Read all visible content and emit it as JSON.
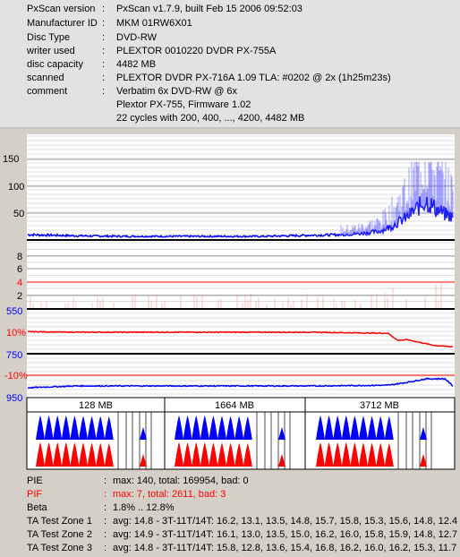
{
  "info": {
    "rows": [
      {
        "label": "PxScan version",
        "value": "PxScan v1.7.9, built Feb 15 2006 09:52:03"
      },
      {
        "label": "Manufacturer ID",
        "value": "MKM 01RW6X01"
      },
      {
        "label": "Disc Type",
        "value": "DVD-RW"
      },
      {
        "label": "writer used",
        "value": "PLEXTOR 0010220 DVDR PX-755A"
      },
      {
        "label": "disc capacity",
        "value": "4482 MB"
      },
      {
        "label": "scanned",
        "value": "PLEXTOR DVDR PX-716A 1.09 TLA: #0202 @ 2x (1h25m23s)"
      },
      {
        "label": "comment",
        "value": "Verbatim 6x DVD-RW @ 6x"
      }
    ],
    "comment_cont": [
      "Plextor PX-755, Firmware 1.02",
      "22 cycles with 200, 400, ..., 4200, 4482 MB"
    ],
    "separator": ":"
  },
  "chart_data": [
    {
      "type": "line",
      "name": "PIE",
      "ylim": [
        0,
        190
      ],
      "yticks": [
        "150",
        "100",
        "50"
      ],
      "xlim_mb": [
        0,
        4482
      ],
      "series": [
        {
          "color": "#0000ff",
          "x_mb": [
            0,
            500,
            1000,
            1500,
            2000,
            2500,
            3000,
            3300,
            3500,
            3700,
            3800,
            3900,
            4000,
            4100,
            4200,
            4300,
            4400,
            4482
          ],
          "y": [
            8,
            6,
            5,
            5,
            5,
            5,
            7,
            8,
            10,
            14,
            20,
            30,
            40,
            55,
            70,
            55,
            45,
            40
          ]
        }
      ]
    },
    {
      "type": "line",
      "name": "PIF",
      "ylim": [
        0,
        10
      ],
      "yticks": [
        "8",
        "6",
        "4",
        "2"
      ],
      "series": [
        {
          "color": "#ff9999",
          "x_mb": [
            0,
            1000,
            2000,
            3000,
            3500,
            4000,
            4482
          ],
          "y": [
            1,
            1,
            1,
            1,
            1,
            2,
            2
          ]
        }
      ]
    },
    {
      "type": "line",
      "name": "jitter",
      "yticks": [
        "550",
        "10%",
        "750"
      ],
      "series": [
        {
          "color": "#ff0000",
          "x_mb": [
            0,
            500,
            1000,
            2000,
            3000,
            3800,
            3900,
            4000,
            4300,
            4482
          ],
          "y": [
            10.1,
            10,
            10,
            10,
            10,
            9.8,
            8.5,
            8.6,
            7.5,
            7.3
          ]
        }
      ]
    },
    {
      "type": "line",
      "name": "beta",
      "yticks": [
        "-10%",
        "950"
      ],
      "series": [
        {
          "color": "#0000ff",
          "x_mb": [
            0,
            500,
            1000,
            2000,
            3000,
            3800,
            4000,
            4200,
            4400,
            4482
          ],
          "y": [
            -13.5,
            -13,
            -13,
            -13,
            -13,
            -12.8,
            -12,
            -11,
            -11,
            -13
          ]
        }
      ]
    }
  ],
  "zones": [
    {
      "label": "128 MB"
    },
    {
      "label": "1664 MB"
    },
    {
      "label": "3712 MB"
    }
  ],
  "stats": {
    "separator": ":",
    "rows": [
      {
        "label": "PIE",
        "value": "max: 140, total: 169954, bad: 0",
        "color": "#000000"
      },
      {
        "label": "PIF",
        "value": "max: 7, total: 2611, bad: 3",
        "color": "#ff0000"
      },
      {
        "label": "Beta",
        "value": "1.8% .. 12.8%",
        "color": "#000000"
      },
      {
        "label": "TA Test Zone 1",
        "value": "avg: 14.8 - 3T-11T/14T: 16.2, 13.1, 13.5, 14.8, 15.7, 15.8, 15.3, 15.6, 14.8, 12.4",
        "color": "#000000"
      },
      {
        "label": "TA Test Zone 2",
        "value": "avg: 14.9 - 3T-11T/14T: 16.1, 13.0, 13.5, 15.0, 16.2, 16.0, 15.8, 15.9, 14.8, 12.7",
        "color": "#000000"
      },
      {
        "label": "TA Test Zone 3",
        "value": "avg: 14.8 - 3T-11T/14T: 15.8, 12.8, 13.6, 15.4, 16.8, 16.2, 16.0, 16.2, 15.3, 11.7",
        "color": "#000000"
      }
    ]
  }
}
